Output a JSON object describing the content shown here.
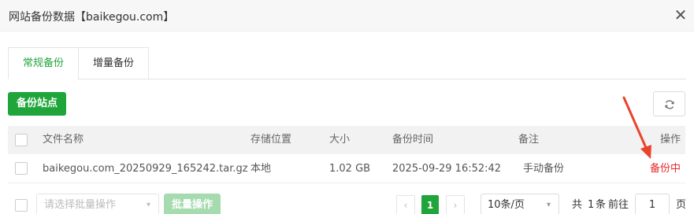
{
  "dialog": {
    "title": "网站备份数据【baikegou.com】",
    "close_icon": "close-icon"
  },
  "tabs": [
    {
      "label": "常规备份",
      "active": true
    },
    {
      "label": "增量备份",
      "active": false
    }
  ],
  "toolbar": {
    "backup_label": "备份站点",
    "refresh_icon": "refresh-icon"
  },
  "table": {
    "columns": [
      "文件名称",
      "存储位置",
      "大小",
      "备份时间",
      "备注",
      "操作"
    ],
    "rows": [
      {
        "name": "baikegou.com_20250929_165242.tar.gz",
        "location": "本地",
        "size": "1.02 GB",
        "time": "2025-09-29 16:52:42",
        "note": "手动备份",
        "action": "备份中"
      }
    ]
  },
  "footer": {
    "batch_placeholder": "请选择批量操作",
    "batch_button": "批量操作",
    "pagination": {
      "prev": "‹",
      "current": "1",
      "next": "›",
      "page_size": "10条/页",
      "total_prefix": "共",
      "total": "1",
      "total_suffix": "条",
      "goto_prefix": "前往",
      "goto_value": "1",
      "goto_suffix": "页"
    }
  },
  "colors": {
    "accent": "#20a53a",
    "status": "#e6282c",
    "annotation_arrow": "#e8442c"
  }
}
